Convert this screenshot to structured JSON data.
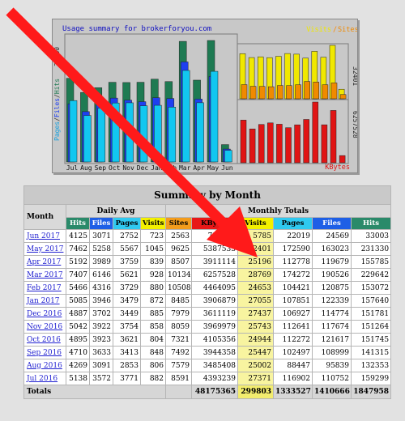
{
  "chart": {
    "title": "Usage summary for brokerforyou.com",
    "y_axis_label_parts": [
      "Pages",
      "Files",
      "Hits"
    ],
    "left_max_label": "31330",
    "months": [
      "Jul",
      "Aug",
      "Sep",
      "Oct",
      "Nov",
      "Dec",
      "Jan",
      "Feb",
      "Mar",
      "Apr",
      "May",
      "Jun"
    ],
    "right_legend_visits": "Visits",
    "right_legend_sites": "Sites",
    "right_top_max": "32401",
    "right_bottom_max": "6257528",
    "kbytes_label": "KBytes"
  },
  "colors": {
    "hits": "#1e7a52",
    "files": "#1e3ff0",
    "pages": "#12c7f0",
    "visits": "#f0e800",
    "sites": "#f08a00",
    "kbytes": "#e01414",
    "arrow": "#ff1a1a",
    "highlight": "#f8f4a0"
  },
  "chart_data": {
    "type": "bar",
    "categories": [
      "Jul",
      "Aug",
      "Sep",
      "Oct",
      "Nov",
      "Dec",
      "Jan",
      "Feb",
      "Mar",
      "Apr",
      "May",
      "Jun"
    ],
    "series": [
      {
        "name": "Hits",
        "values": [
          159299,
          132353,
          141315,
          151745,
          151264,
          151781,
          157640,
          153072,
          229642,
          155785,
          231330,
          33003
        ]
      },
      {
        "name": "Files",
        "values": [
          110752,
          95839,
          108999,
          121617,
          117674,
          114774,
          122339,
          120875,
          190526,
          119679,
          163023,
          24569
        ]
      },
      {
        "name": "Pages",
        "values": [
          116902,
          88447,
          102497,
          112272,
          112641,
          106927,
          107851,
          104421,
          174272,
          112778,
          172590,
          22019
        ]
      },
      {
        "name": "Visits",
        "values": [
          27371,
          25002,
          25447,
          24944,
          25743,
          27437,
          27055,
          24653,
          28769,
          25196,
          32401,
          5785
        ]
      },
      {
        "name": "Sites",
        "values": [
          8591,
          7579,
          7492,
          7321,
          8059,
          7979,
          8485,
          10508,
          10134,
          8507,
          9625,
          2563
        ]
      },
      {
        "name": "KBytes",
        "values": [
          4393239,
          3485408,
          3944358,
          4105356,
          3969979,
          3611119,
          3906879,
          4464095,
          6257528,
          3911114,
          5387533,
          738708
        ]
      }
    ]
  },
  "table": {
    "title": "Summary by Month",
    "group_daily": "Daily Avg",
    "group_monthly": "Monthly Totals",
    "month_header": "Month",
    "daily_headers": [
      "Hits",
      "Files",
      "Pages",
      "Visits"
    ],
    "monthly_headers": [
      "Sites",
      "KBytes",
      "Visits",
      "Pages",
      "Files",
      "Hits"
    ],
    "rows": [
      {
        "month": "Jun 2017",
        "d": [
          "4125",
          "3071",
          "2752",
          "723"
        ],
        "m": [
          "2563",
          "738708",
          "5785",
          "22019",
          "24569",
          "33003"
        ]
      },
      {
        "month": "May 2017",
        "d": [
          "7462",
          "5258",
          "5567",
          "1045"
        ],
        "m": [
          "9625",
          "5387533",
          "32401",
          "172590",
          "163023",
          "231330"
        ]
      },
      {
        "month": "Apr 2017",
        "d": [
          "5192",
          "3989",
          "3759",
          "839"
        ],
        "m": [
          "8507",
          "3911114",
          "25196",
          "112778",
          "119679",
          "155785"
        ]
      },
      {
        "month": "Mar 2017",
        "d": [
          "7407",
          "6146",
          "5621",
          "928"
        ],
        "m": [
          "10134",
          "6257528",
          "28769",
          "174272",
          "190526",
          "229642"
        ]
      },
      {
        "month": "Feb 2017",
        "d": [
          "5466",
          "4316",
          "3729",
          "880"
        ],
        "m": [
          "10508",
          "4464095",
          "24653",
          "104421",
          "120875",
          "153072"
        ]
      },
      {
        "month": "Jan 2017",
        "d": [
          "5085",
          "3946",
          "3479",
          "872"
        ],
        "m": [
          "8485",
          "3906879",
          "27055",
          "107851",
          "122339",
          "157640"
        ]
      },
      {
        "month": "Dec 2016",
        "d": [
          "4887",
          "3702",
          "3449",
          "885"
        ],
        "m": [
          "7979",
          "3611119",
          "27437",
          "106927",
          "114774",
          "151781"
        ]
      },
      {
        "month": "Nov 2016",
        "d": [
          "5042",
          "3922",
          "3754",
          "858"
        ],
        "m": [
          "8059",
          "3969979",
          "25743",
          "112641",
          "117674",
          "151264"
        ]
      },
      {
        "month": "Oct 2016",
        "d": [
          "4895",
          "3923",
          "3621",
          "804"
        ],
        "m": [
          "7321",
          "4105356",
          "24944",
          "112272",
          "121617",
          "151745"
        ]
      },
      {
        "month": "Sep 2016",
        "d": [
          "4710",
          "3633",
          "3413",
          "848"
        ],
        "m": [
          "7492",
          "3944358",
          "25447",
          "102497",
          "108999",
          "141315"
        ]
      },
      {
        "month": "Aug 2016",
        "d": [
          "4269",
          "3091",
          "2853",
          "806"
        ],
        "m": [
          "7579",
          "3485408",
          "25002",
          "88447",
          "95839",
          "132353"
        ]
      },
      {
        "month": "Jul 2016",
        "d": [
          "5138",
          "3572",
          "3771",
          "882"
        ],
        "m": [
          "8591",
          "4393239",
          "27371",
          "116902",
          "110752",
          "159299"
        ]
      }
    ],
    "totals_label": "Totals",
    "totals": [
      "",
      "48175365",
      "299803",
      "1333527",
      "1410666",
      "1847958"
    ]
  }
}
